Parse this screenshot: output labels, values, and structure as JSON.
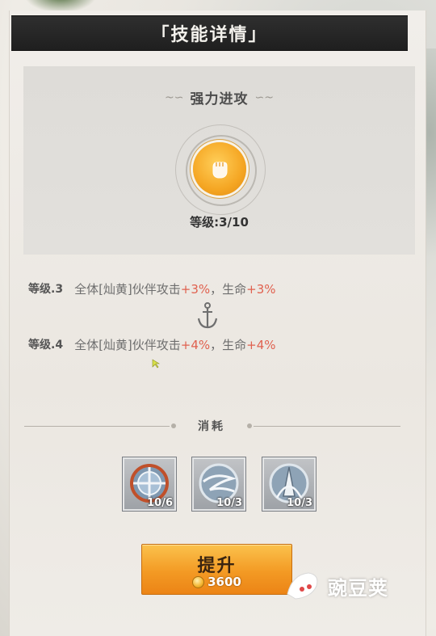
{
  "title": "「技能详情」",
  "skill": {
    "name": "强力进攻",
    "level_text": "等级:3/10",
    "icon": "fist-icon",
    "icon_color": "#f5a623"
  },
  "levels": [
    {
      "label": "等级.3",
      "desc_a": "全体[灿黄]伙伴攻击",
      "value_a": "+3%",
      "sep": "，生命",
      "value_b": "+3%"
    },
    {
      "label": "等级.4",
      "desc_a": "全体[灿黄]伙伴攻击",
      "value_a": "+4%",
      "sep": "，生命",
      "value_b": "+4%"
    }
  ],
  "consume": {
    "label": "消耗",
    "items": [
      {
        "icon": "shield-crest-icon",
        "count": "10/6"
      },
      {
        "icon": "wind-emblem-icon",
        "count": "10/3"
      },
      {
        "icon": "tower-emblem-icon",
        "count": "10/3"
      }
    ]
  },
  "upgrade": {
    "label": "提升",
    "cost": "3600",
    "currency_icon": "coin-icon"
  },
  "watermark": {
    "text": "豌豆荚"
  },
  "colors": {
    "accent_orange": "#f39a24",
    "value_red": "#e0614f",
    "title_bg": "#262626"
  }
}
